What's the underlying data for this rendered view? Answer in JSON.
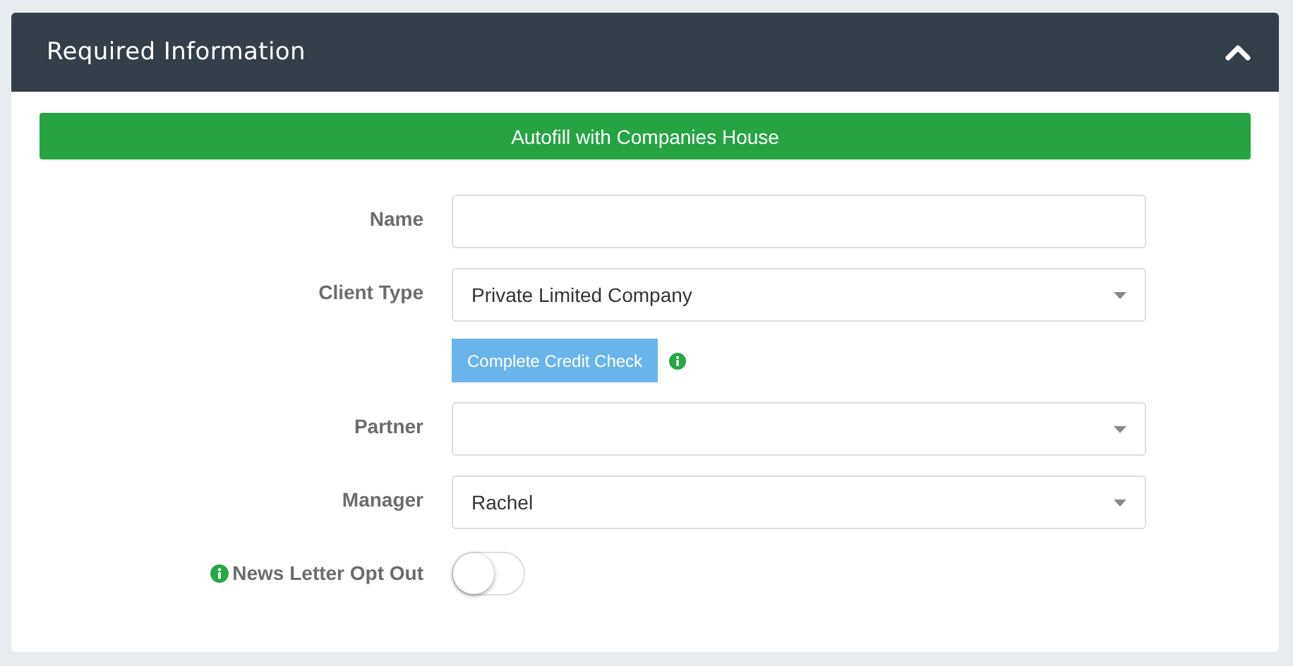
{
  "panel": {
    "title": "Required Information",
    "expanded": true
  },
  "autofill_button": "Autofill with Companies House",
  "fields": [
    {
      "kind": "text",
      "label": "Name"
    },
    {
      "kind": "select",
      "label": "Client Type",
      "value": "Private Limited Company"
    },
    {
      "kind": "button",
      "label": "Complete Credit Check",
      "info": true
    },
    {
      "kind": "select",
      "label": "Partner"
    },
    {
      "kind": "select",
      "label": "Manager",
      "value": "Rachel"
    },
    {
      "kind": "toggle",
      "label": "News Letter Opt Out",
      "info": true,
      "on": false
    }
  ]
}
